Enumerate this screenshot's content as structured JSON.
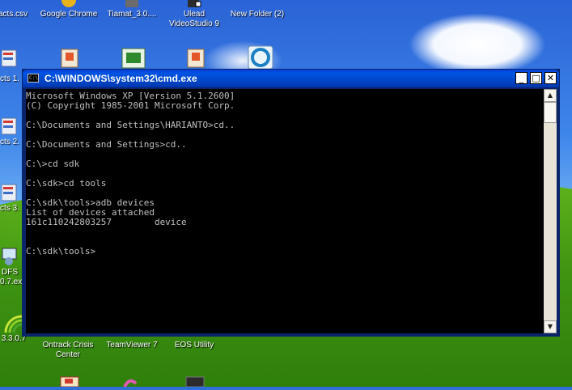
{
  "desktop": {
    "icons": [
      {
        "label": "acts.csv",
        "icon": "spreadsheet-file-icon"
      },
      {
        "label": "Google Chrome",
        "icon": "chrome-icon"
      },
      {
        "label": "Tiamat_3.0....",
        "icon": "shortcut-icon"
      },
      {
        "label": "Ulead",
        "label2": "VideoStudio 9",
        "icon": "videostudio-icon"
      },
      {
        "label": "New Folder (2)",
        "icon": "folder-icon"
      },
      {
        "label": "cts 1.",
        "icon": "spreadsheet-file-icon"
      },
      {
        "label": "cts 2.",
        "icon": "spreadsheet-file-icon"
      },
      {
        "label": "cts 3.",
        "icon": "spreadsheet-file-icon"
      },
      {
        "label": "DFS",
        "label2": "0.7.ex",
        "icon": "app-icon"
      },
      {
        "label": "3.3.0.7",
        "icon": "signal-icon"
      },
      {
        "label": "Ontrack Crisis",
        "label2": "Center",
        "icon": "ontrack-icon"
      },
      {
        "label": "TeamViewer 7",
        "icon": "teamviewer-icon"
      },
      {
        "label": "EOS Utility",
        "icon": "camera-icon"
      }
    ]
  },
  "window": {
    "title": "C:\\WINDOWS\\system32\\cmd.exe",
    "title_icon_text": "C:\\",
    "minimize": "_",
    "maximize": "□",
    "close": "✕"
  },
  "console": {
    "lines": [
      "Microsoft Windows XP [Version 5.1.2600]",
      "(C) Copyright 1985-2001 Microsoft Corp.",
      "",
      "C:\\Documents and Settings\\HARIANTO>cd..",
      "",
      "C:\\Documents and Settings>cd..",
      "",
      "C:\\>cd sdk",
      "",
      "C:\\sdk>cd tools",
      "",
      "C:\\sdk\\tools>adb devices",
      "List of devices attached",
      "161c110242803257        device",
      "",
      "",
      "C:\\sdk\\tools>"
    ]
  },
  "scrollbar": {
    "up": "▲",
    "down": "▼"
  }
}
